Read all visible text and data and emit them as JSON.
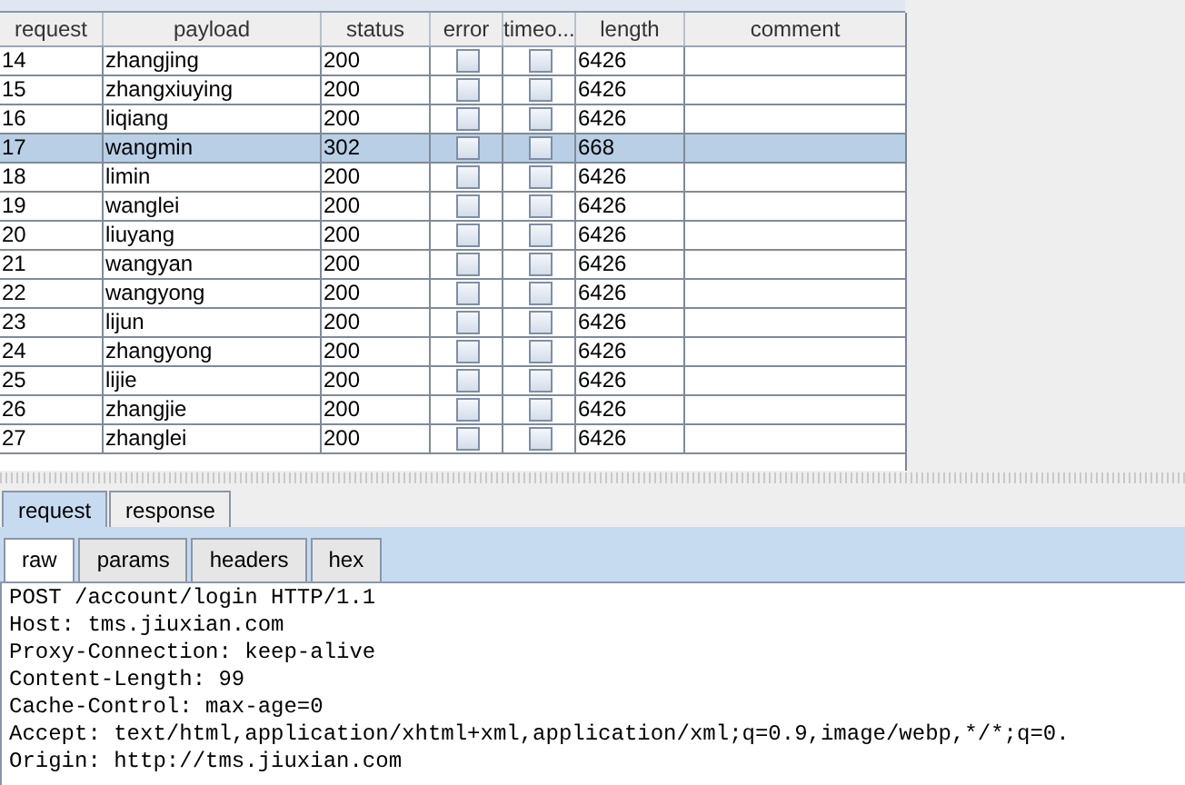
{
  "table": {
    "columns": [
      "request",
      "payload",
      "status",
      "error",
      "timeo...",
      "length",
      "comment"
    ],
    "rows": [
      {
        "request": "14",
        "payload": "zhangjing",
        "status": "200",
        "error": false,
        "timeout": false,
        "length": "6426",
        "selected": false
      },
      {
        "request": "15",
        "payload": "zhangxiuying",
        "status": "200",
        "error": false,
        "timeout": false,
        "length": "6426",
        "selected": false
      },
      {
        "request": "16",
        "payload": "liqiang",
        "status": "200",
        "error": false,
        "timeout": false,
        "length": "6426",
        "selected": false
      },
      {
        "request": "17",
        "payload": "wangmin",
        "status": "302",
        "error": false,
        "timeout": false,
        "length": "668",
        "selected": true
      },
      {
        "request": "18",
        "payload": "limin",
        "status": "200",
        "error": false,
        "timeout": false,
        "length": "6426",
        "selected": false
      },
      {
        "request": "19",
        "payload": "wanglei",
        "status": "200",
        "error": false,
        "timeout": false,
        "length": "6426",
        "selected": false
      },
      {
        "request": "20",
        "payload": "liuyang",
        "status": "200",
        "error": false,
        "timeout": false,
        "length": "6426",
        "selected": false
      },
      {
        "request": "21",
        "payload": "wangyan",
        "status": "200",
        "error": false,
        "timeout": false,
        "length": "6426",
        "selected": false
      },
      {
        "request": "22",
        "payload": "wangyong",
        "status": "200",
        "error": false,
        "timeout": false,
        "length": "6426",
        "selected": false
      },
      {
        "request": "23",
        "payload": "lijun",
        "status": "200",
        "error": false,
        "timeout": false,
        "length": "6426",
        "selected": false
      },
      {
        "request": "24",
        "payload": "zhangyong",
        "status": "200",
        "error": false,
        "timeout": false,
        "length": "6426",
        "selected": false
      },
      {
        "request": "25",
        "payload": "lijie",
        "status": "200",
        "error": false,
        "timeout": false,
        "length": "6426",
        "selected": false
      },
      {
        "request": "26",
        "payload": "zhangjie",
        "status": "200",
        "error": false,
        "timeout": false,
        "length": "6426",
        "selected": false
      },
      {
        "request": "27",
        "payload": "zhanglei",
        "status": "200",
        "error": false,
        "timeout": false,
        "length": "6426",
        "selected": false
      }
    ]
  },
  "tabs": [
    {
      "label": "request",
      "selected": true
    },
    {
      "label": "response",
      "selected": false
    }
  ],
  "subtabs": [
    {
      "label": "raw",
      "selected": true
    },
    {
      "label": "params",
      "selected": false
    },
    {
      "label": "headers",
      "selected": false
    },
    {
      "label": "hex",
      "selected": false
    }
  ],
  "raw_lines": [
    "POST /account/login HTTP/1.1",
    "Host: tms.jiuxian.com",
    "Proxy-Connection: keep-alive",
    "Content-Length: 99",
    "Cache-Control: max-age=0",
    "Accept: text/html,application/xhtml+xml,application/xml;q=0.9,image/webp,*/*;q=0.",
    "Origin: http://tms.jiuxian.com"
  ]
}
